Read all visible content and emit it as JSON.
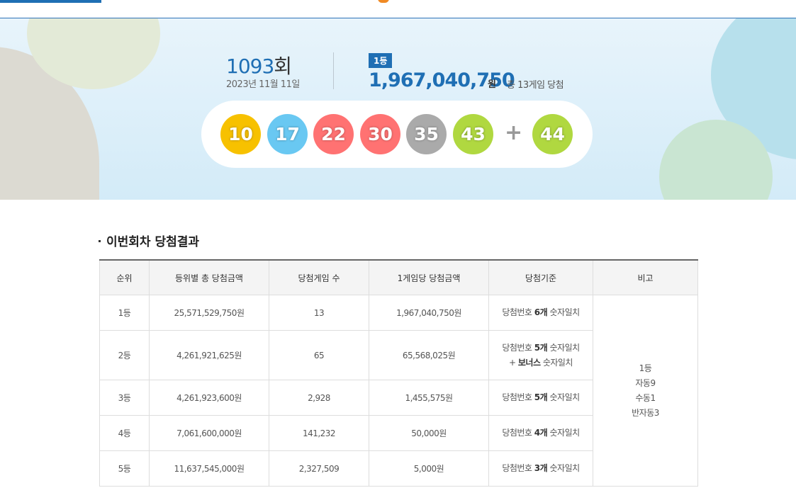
{
  "hero": {
    "draw_number": "1093",
    "draw_suffix": "회",
    "draw_date": "2023년 11월 11일",
    "rank_badge": "1등",
    "prize_amount": "1,967,040,750",
    "prize_unit": "원",
    "winner_text": "총 13게임 당첨",
    "balls": [
      {
        "value": "10",
        "color": "#f7c100"
      },
      {
        "value": "17",
        "color": "#69c8f2"
      },
      {
        "value": "22",
        "color": "#ff7272"
      },
      {
        "value": "30",
        "color": "#ff7272"
      },
      {
        "value": "35",
        "color": "#aaaaaa"
      },
      {
        "value": "43",
        "color": "#b0d840"
      }
    ],
    "plus": "+",
    "bonus_ball": {
      "value": "44",
      "color": "#b0d840"
    }
  },
  "section": {
    "title": "이번회차 당첨결과"
  },
  "table": {
    "headers": [
      "순위",
      "등위별 총 당첨금액",
      "당첨게임 수",
      "1게임당 당첨금액",
      "당첨기준",
      "비고"
    ],
    "rows": [
      {
        "rank": "1등",
        "total": "25,571,529,750원",
        "games": "13",
        "per_game": "1,967,040,750원",
        "criteria_prefix": "당첨번호 ",
        "criteria_bold": "6개",
        "criteria_suffix": " 숫자일치",
        "criteria_line2": ""
      },
      {
        "rank": "2등",
        "total": "4,261,921,625원",
        "games": "65",
        "per_game": "65,568,025원",
        "criteria_prefix": "당첨번호 ",
        "criteria_bold": "5개",
        "criteria_suffix": " 숫자일치",
        "criteria_line2_prefix": "+ ",
        "criteria_line2_bold": "보너스",
        "criteria_line2_suffix": " 숫자일치"
      },
      {
        "rank": "3등",
        "total": "4,261,923,600원",
        "games": "2,928",
        "per_game": "1,455,575원",
        "criteria_prefix": "당첨번호 ",
        "criteria_bold": "5개",
        "criteria_suffix": " 숫자일치"
      },
      {
        "rank": "4등",
        "total": "7,061,600,000원",
        "games": "141,232",
        "per_game": "50,000원",
        "criteria_prefix": "당첨번호 ",
        "criteria_bold": "4개",
        "criteria_suffix": " 숫자일치"
      },
      {
        "rank": "5등",
        "total": "11,637,545,000원",
        "games": "2,327,509",
        "per_game": "5,000원",
        "criteria_prefix": "당첨번호 ",
        "criteria_bold": "3개",
        "criteria_suffix": " 숫자일치"
      }
    ],
    "note": [
      "1등",
      "자동9",
      "수동1",
      "반자동3"
    ]
  }
}
